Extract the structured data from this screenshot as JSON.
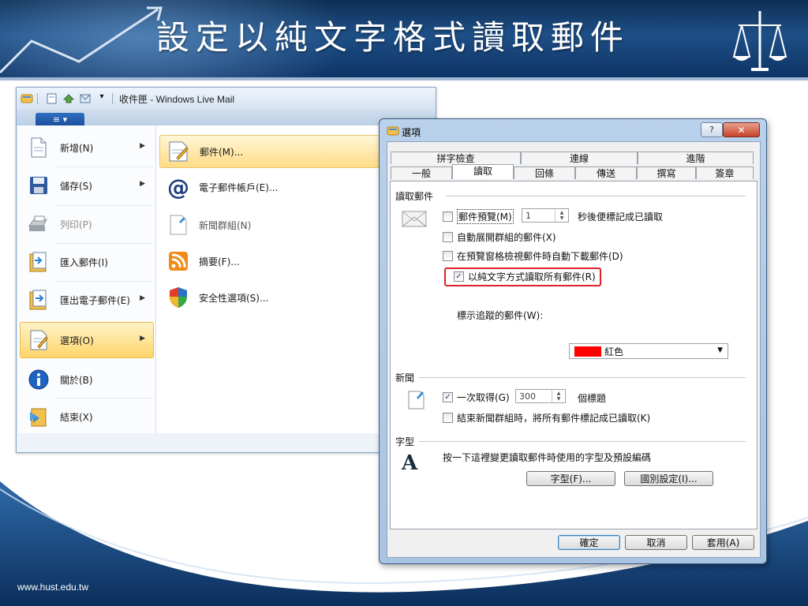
{
  "slide": {
    "title": "設定以純文字格式讀取郵件",
    "footer_url": "www.hust.edu.tw"
  },
  "wlm_window": {
    "title": "收件匣 - Windows Live Mail",
    "app_button_label": "≡ ▾",
    "left_menu": [
      {
        "label": "新增(N)",
        "icon": "new-document-icon",
        "has_submenu": true
      },
      {
        "label": "儲存(S)",
        "icon": "save-disk-icon",
        "has_submenu": true
      },
      {
        "label": "列印(P)",
        "icon": "printer-icon",
        "has_submenu": false,
        "disabled": true
      },
      {
        "label": "匯入郵件(I)",
        "icon": "import-icon",
        "has_submenu": false
      },
      {
        "label": "匯出電子郵件(E)",
        "icon": "export-icon",
        "has_submenu": true
      },
      {
        "label": "選項(O)",
        "icon": "options-icon",
        "has_submenu": true,
        "active": true
      },
      {
        "label": "關於(B)",
        "icon": "info-icon",
        "has_submenu": false
      },
      {
        "label": "結束(X)",
        "icon": "exit-icon",
        "has_submenu": false
      }
    ],
    "submenu": [
      {
        "label": "郵件(M)...",
        "icon": "mail-options-icon",
        "highlighted": true
      },
      {
        "label": "電子郵件帳戶(E)...",
        "icon": "at-sign-icon"
      },
      {
        "label": "新聞群組(N)",
        "icon": "newsgroup-icon",
        "disabled": true
      },
      {
        "label": "摘要(F)...",
        "icon": "rss-feed-icon"
      },
      {
        "label": "安全性選項(S)...",
        "icon": "security-shield-icon"
      }
    ]
  },
  "options_dialog": {
    "title": "選項",
    "help_glyph": "?",
    "close_glyph": "✕",
    "tabs_row1": [
      "拼字檢查",
      "連線",
      "進階"
    ],
    "tabs_row2": [
      "一般",
      "讀取",
      "回條",
      "傳送",
      "撰寫",
      "簽章"
    ],
    "selected_tab": "讀取",
    "read_group": {
      "header": "讀取郵件",
      "preview": {
        "checked": false,
        "label": "郵件預覽(M)",
        "value": "1",
        "suffix": "秒後便標記成已讀取"
      },
      "expand": {
        "checked": false,
        "label": "自動展開群組的郵件(X)"
      },
      "auto_download": {
        "checked": false,
        "label": "在預覽窗格檢視郵件時自動下載郵件(D)"
      },
      "plain_text": {
        "checked": true,
        "label": "以純文字方式讀取所有郵件(R)"
      },
      "flag_label": "標示追蹤的郵件(W):",
      "flag_color_name": "紅色",
      "flag_color": "#ff0000"
    },
    "news_group": {
      "header": "新聞",
      "get_headers": {
        "checked": true,
        "label": "一次取得(G)",
        "value": "300",
        "suffix": "個標題"
      },
      "mark_read": {
        "checked": false,
        "label": "結束新聞群組時，將所有郵件標記成已讀取(K)"
      }
    },
    "font_group": {
      "header": "字型",
      "description": "按一下這裡變更讀取郵件時使用的字型及預設編碼",
      "font_button": "字型(F)...",
      "intl_button": "國別設定(I)..."
    },
    "buttons": {
      "ok": "確定",
      "cancel": "取消",
      "apply": "套用(A)"
    },
    "check_glyph": "✓"
  }
}
